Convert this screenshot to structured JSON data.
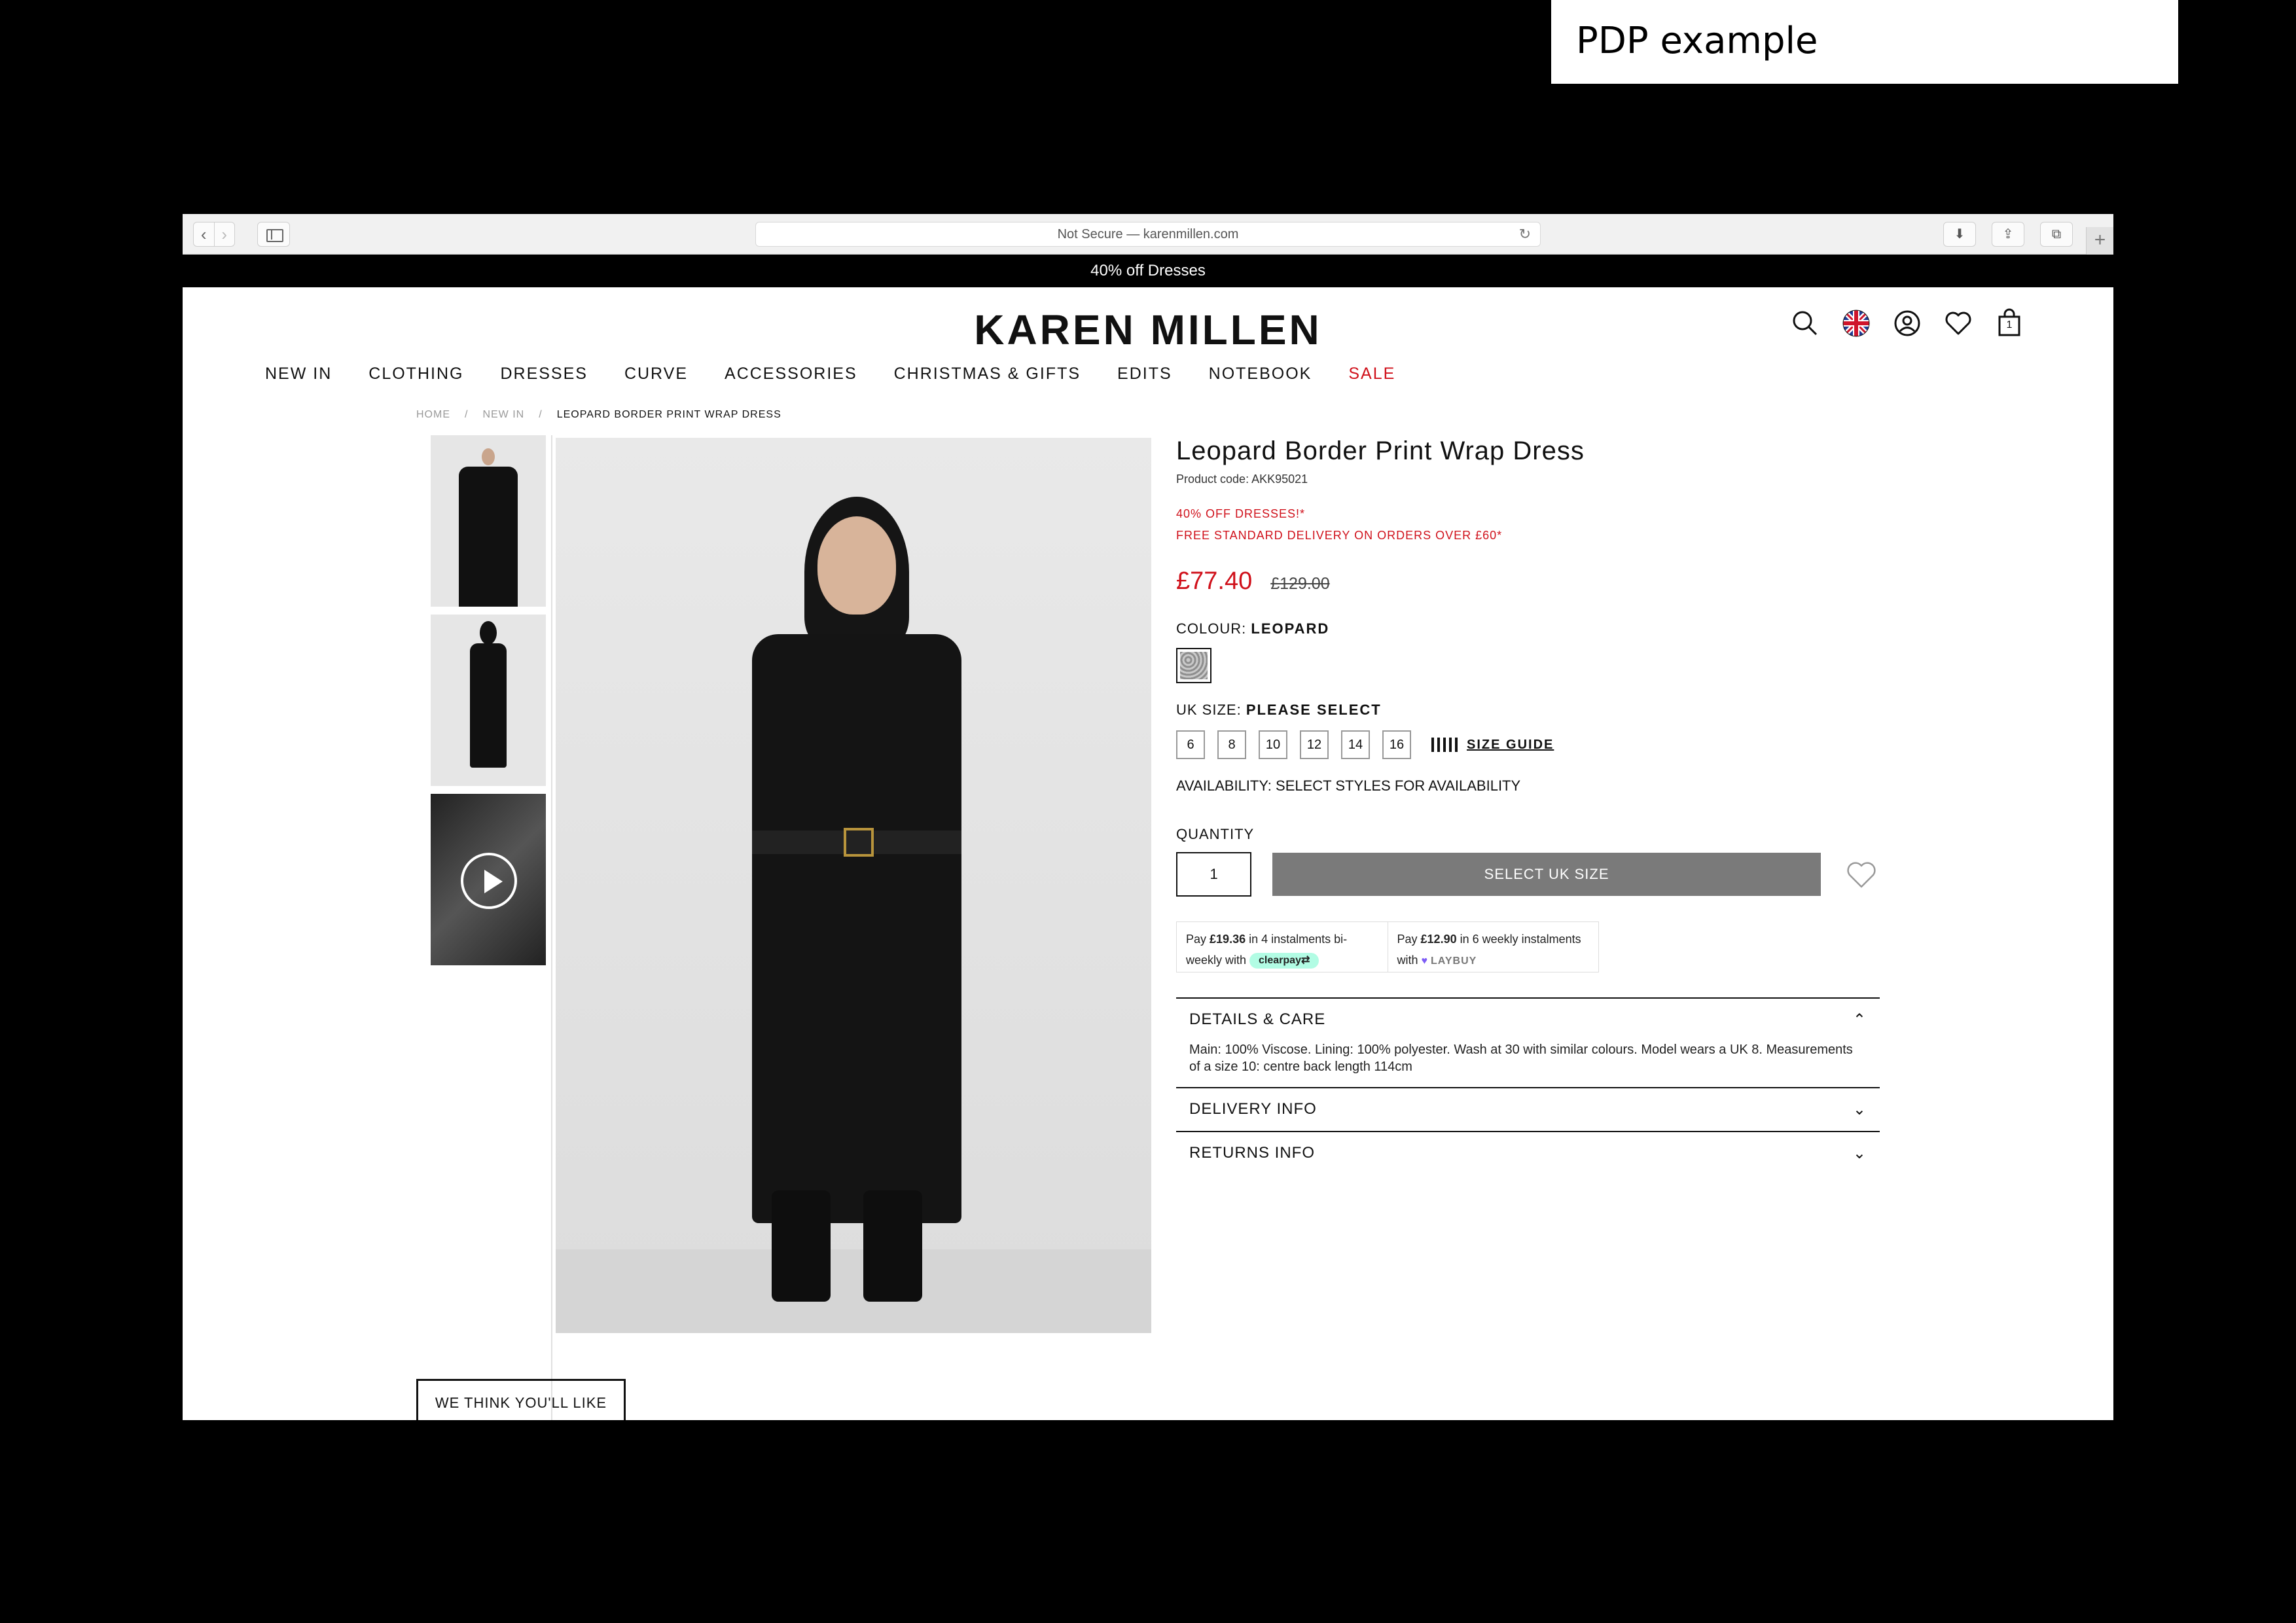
{
  "slide_label": "PDP example",
  "browser": {
    "url_text": "Not Secure — karenmillen.com",
    "back_glyph": "‹",
    "forward_glyph": "›",
    "reload_glyph": "↻",
    "download_glyph": "⬇",
    "share_glyph": "⇪",
    "tabs_glyph": "⧉",
    "newtab_glyph": "+"
  },
  "promo_banner": "40% off Dresses",
  "site": {
    "logo": "KAREN MILLEN"
  },
  "header_icons": [
    "search-icon",
    "uk-flag-icon",
    "account-icon",
    "wishlist-icon",
    "bag-icon"
  ],
  "bag_count": "1",
  "nav": {
    "items": [
      "NEW IN",
      "CLOTHING",
      "DRESSES",
      "CURVE",
      "ACCESSORIES",
      "CHRISTMAS & GIFTS",
      "EDITS",
      "NOTEBOOK"
    ],
    "sale": "SALE",
    "sale_color": "#d0111b"
  },
  "breadcrumb": {
    "home": "HOME",
    "section": "NEW IN",
    "current": "LEOPARD BORDER PRINT WRAP DRESS",
    "separator": "/"
  },
  "product": {
    "title": "Leopard Border Print Wrap Dress",
    "code": "Product code: AKK95021",
    "offer_1": "40% OFF DRESSES!*",
    "offer_2": "FREE STANDARD DELIVERY ON ORDERS OVER £60*",
    "price": "£77.40",
    "was_price": "£129.00",
    "colour_label": "COLOUR:",
    "colour_value": "LEOPARD",
    "size_label": "UK SIZE:",
    "size_value": "PLEASE SELECT",
    "sizes": [
      "6",
      "8",
      "10",
      "12",
      "14",
      "16"
    ],
    "size_guide": "SIZE GUIDE",
    "availability": "AVAILABILITY:  SELECT STYLES FOR AVAILABILITY",
    "quantity_label": "QUANTITY",
    "quantity_value": "1",
    "cta": "SELECT UK SIZE",
    "cta_color": "#7a7a7a"
  },
  "bnpl": {
    "clearpay_pre": "Pay ",
    "clearpay_amount": "£19.36",
    "clearpay_text": " in 4 instalments bi-weekly with ",
    "clearpay_brand": "clearpay⇄",
    "laybuy_pre": "Pay ",
    "laybuy_amount": "£12.90",
    "laybuy_text": " in 6 weekly instalments with ",
    "laybuy_mark": "♥",
    "laybuy_brand": "LAYBUY"
  },
  "accordions": {
    "details_title": "DETAILS & CARE",
    "details_body": "Main: 100% Viscose. Lining: 100% polyester. Wash at 30 with similar colours. Model wears a UK 8. Measurements of a size 10: centre back length 114cm",
    "delivery_title": "DELIVERY INFO",
    "returns_title": "RETURNS INFO",
    "chev_up": "⌃",
    "chev_down": "⌄"
  },
  "recommendations_tab": "WE THINK YOU'LL LIKE"
}
